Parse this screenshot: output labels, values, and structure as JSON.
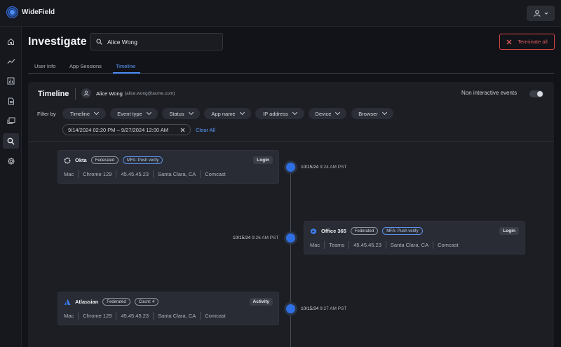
{
  "app": {
    "brand": "WideField"
  },
  "page": {
    "title": "Investigate",
    "search_value": "Alice Wong",
    "terminate_label": "Terminate all"
  },
  "tabs": [
    {
      "label": "User Info"
    },
    {
      "label": "App Sessions"
    },
    {
      "label": "Timeline"
    }
  ],
  "panel": {
    "title": "Timeline",
    "user_name": "Alice Wong",
    "user_email": "(alice.wong@acme.com)",
    "non_interactive_label": "Non interactive events",
    "filter_label": "Filter by",
    "filters": [
      "Timeline",
      "Event type",
      "Status",
      "App name",
      "IP address",
      "Device",
      "Browser"
    ],
    "date_range": "9/14/2024 02:20 PM – 9/27/2024 12:00 AM",
    "clear_all": "Clear All"
  },
  "events": [
    {
      "app": "Okta",
      "badges": [
        "Federated",
        "MFA: Push verify"
      ],
      "type": "Login",
      "meta": [
        "Mac",
        "Chrome 129",
        "45.45.45.23",
        "Santa Clara, CA",
        "Comcast"
      ],
      "date": "10/15/24",
      "time": "9:24 AM PST"
    },
    {
      "app": "Office 365",
      "badges": [
        "Federated",
        "MFA: Push verify"
      ],
      "type": "Login",
      "meta": [
        "Mac",
        "Teams",
        "45.45.45.23",
        "Santa Clara, CA",
        "Comcast"
      ],
      "date": "10/15/24",
      "time": "9:26 AM PST"
    },
    {
      "app": "Atlassian",
      "badges": [
        "Federated",
        "Count: 4"
      ],
      "type": "Activity",
      "meta": [
        "Mac",
        "Chrome 129",
        "45.45.45.23",
        "Santa Clara, CA",
        "Comcast"
      ],
      "date": "10/15/24",
      "time": "9:27 AM PST"
    }
  ],
  "colors": {
    "accent": "#4d8ef5",
    "danger": "#e25c5c",
    "background": "#111318",
    "panel": "#1c1e24"
  }
}
